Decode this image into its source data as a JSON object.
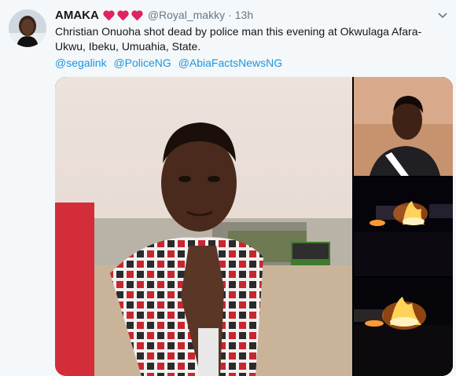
{
  "tweet": {
    "display_name": "AMAKA",
    "handle": "@Royal_makky",
    "separator": "·",
    "time": "13h",
    "text": "Christian Onuoha shot dead by police man this evening at Okwulaga Afara-Ukwu, Ibeku, Umuahia, State.",
    "mentions": [
      "@segalink",
      "@PoliceNG",
      "@AbiaFactsNewsNG"
    ],
    "heart_color": "#e0245e",
    "accent_color": "#1b95e0"
  },
  "icons": [
    "avatar",
    "heart-icon",
    "chevron-down-icon"
  ]
}
